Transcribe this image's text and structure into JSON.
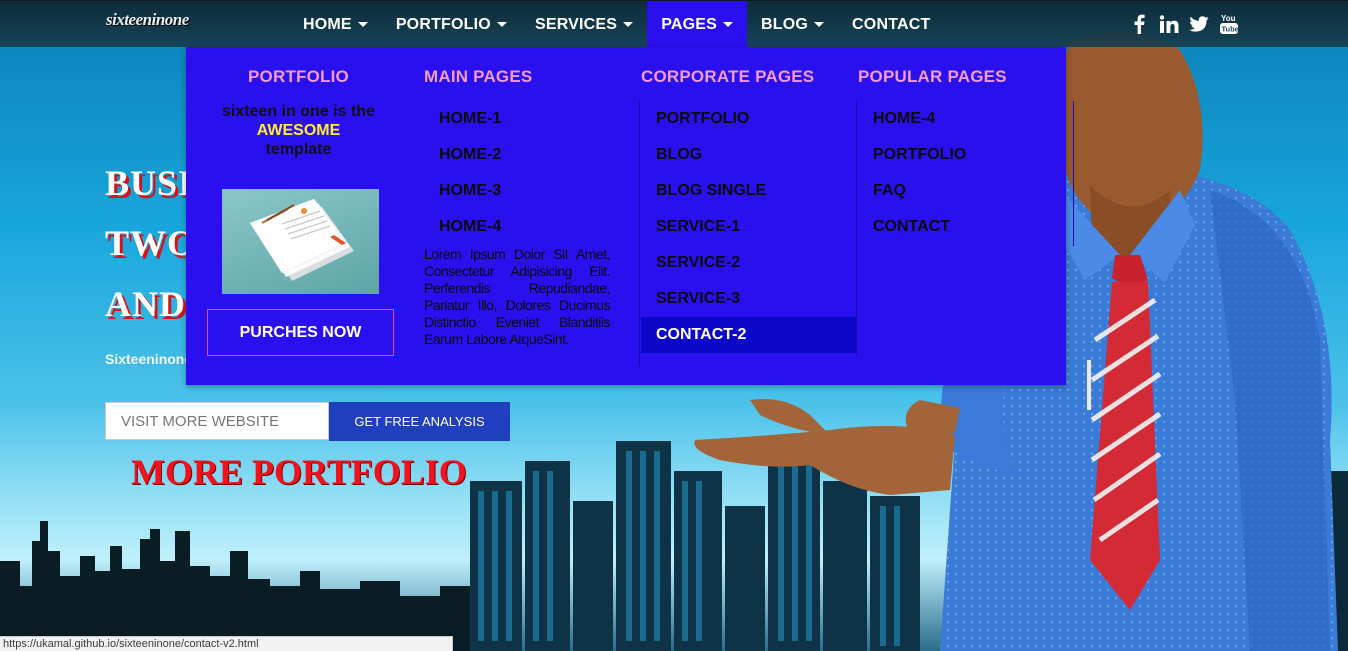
{
  "navbar": {
    "logo": "sixteeninone",
    "menu": [
      {
        "label": "HOME",
        "caret": true
      },
      {
        "label": "PORTFOLIO",
        "caret": true
      },
      {
        "label": "SERVICES",
        "caret": true
      },
      {
        "label": "PAGES",
        "caret": true,
        "active": true
      },
      {
        "label": "BLOG",
        "caret": true
      },
      {
        "label": "CONTACT",
        "caret": false
      }
    ],
    "socials": [
      "facebook-icon",
      "linkedin-icon",
      "twitter-icon",
      "youtube-icon"
    ]
  },
  "hero": {
    "title_lines": [
      "BUSI",
      "TWO",
      "AND"
    ],
    "subtitle": "Sixteeninone",
    "input_placeholder": "VISIT MORE WEBSITE",
    "analysis_button": "GET FREE ANALYSIS",
    "more_portfolio": "MORE PORTFOLIO"
  },
  "mega_menu": {
    "portfolio": {
      "title": "PORTFOLIO",
      "intro_line1": "sixteen in one is the",
      "intro_highlight": "AWESOME",
      "intro_line3": "template",
      "button": "PURCHES NOW"
    },
    "main_pages": {
      "title": "MAIN PAGES",
      "links": [
        "HOME-1",
        "HOME-2",
        "HOME-3",
        "HOME-4"
      ],
      "lorem": "Lorem Ipsum Dolor Sit Amet, Consectetur Adipisicing Elit. Perferendis Repudiandae, Pariatur Illo, Dolores Ducimus Distinctio Eveniet Blanditiis Earum Labore AtqueSint."
    },
    "corporate_pages": {
      "title": "CORPORATE PAGES",
      "links": [
        "PORTFOLIO",
        "BLOG",
        "BLOG SINGLE",
        "SERVICE-1",
        "SERVICE-2",
        "SERVICE-3",
        "CONTACT-2"
      ],
      "active": "CONTACT-2"
    },
    "popular_pages": {
      "title": "POPULAR PAGES",
      "links": [
        "HOME-4",
        "PORTFOLIO",
        "FAQ",
        "CONTACT"
      ]
    }
  },
  "statusbar": {
    "url": "https://ukamal.github.io/sixteeninone/contact-v2.html"
  },
  "colors": {
    "mega_bg": "#2a10ee",
    "column_title": "#f29bcf",
    "highlight": "#ffef2a",
    "active_link_bg": "#0c08c8",
    "hero_title_shadow": "#d4141c",
    "more_portfolio": "#f2121d"
  }
}
